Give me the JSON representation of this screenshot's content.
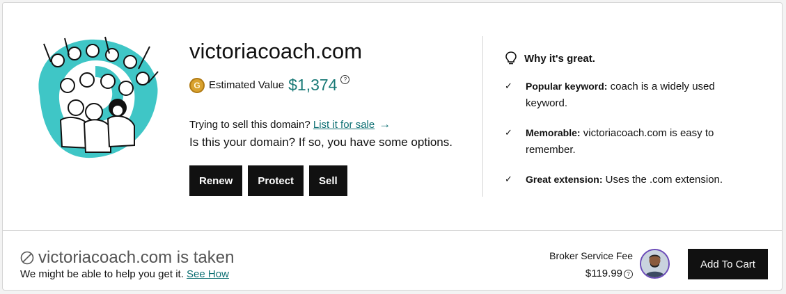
{
  "domain": {
    "name": "victoriacoach.com",
    "coin_letter": "G",
    "estimated_value_label": "Estimated Value",
    "estimated_value": "$1,374",
    "info_icon": "question-circle-icon",
    "sell_prompt": "Trying to sell this domain?",
    "list_link": "List it for sale",
    "owner_prompt": "Is this your domain? If so, you have some options."
  },
  "actions": {
    "renew": "Renew",
    "protect": "Protect",
    "sell": "Sell"
  },
  "why": {
    "heading": "Why it's great.",
    "features": [
      {
        "title": "Popular keyword:",
        "text": "coach is a widely used keyword."
      },
      {
        "title": "Memorable:",
        "text": "victoriacoach.com is easy to remember."
      },
      {
        "title": "Great extension:",
        "text": "Uses the .com extension."
      }
    ]
  },
  "broker": {
    "taken_text": "victoriacoach.com is taken",
    "help_text": "We might be able to help you get it.",
    "see_how": "See How",
    "fee_label": "Broker Service Fee",
    "fee_price": "$119.99",
    "add_to_cart": "Add To Cart"
  },
  "colors": {
    "accent_teal": "#1a7a77",
    "link_teal": "#0d6f73",
    "illustration_teal": "#3fc6c6",
    "button_black": "#111111"
  }
}
